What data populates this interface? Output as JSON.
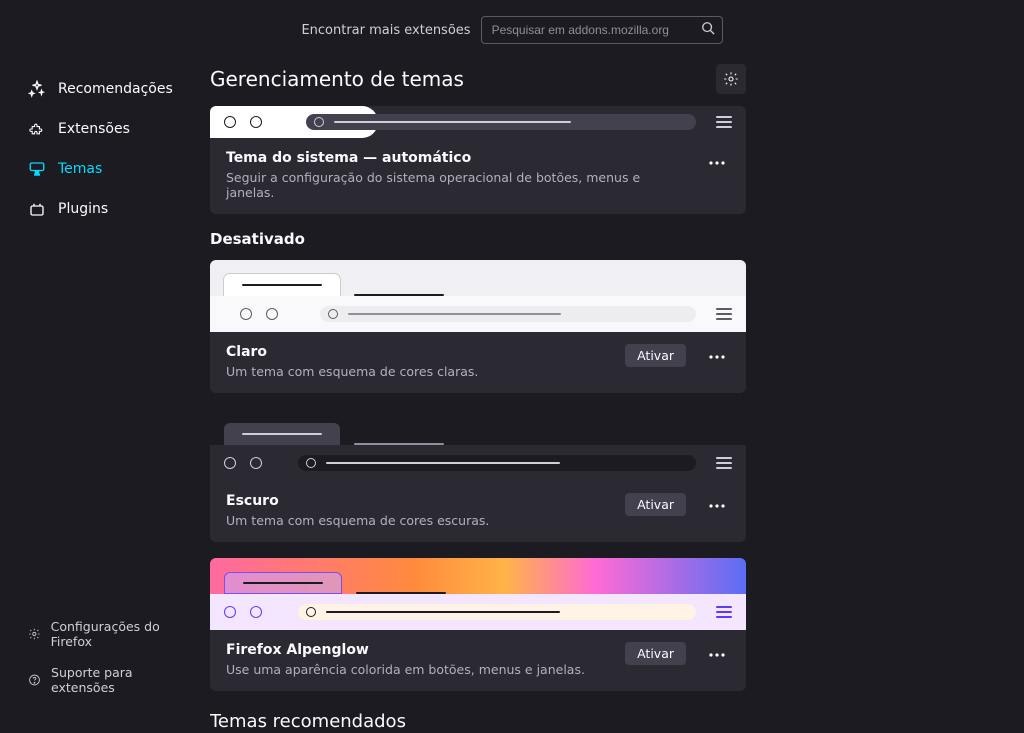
{
  "search": {
    "label": "Encontrar mais extensões",
    "placeholder": "Pesquisar em addons.mozilla.org"
  },
  "sidebar": {
    "items": [
      {
        "label": "Recomendações"
      },
      {
        "label": "Extensões"
      },
      {
        "label": "Temas"
      },
      {
        "label": "Plugins"
      }
    ]
  },
  "footer": {
    "settings": "Configurações do Firefox",
    "support": "Suporte para extensões"
  },
  "main": {
    "title": "Gerenciamento de temas",
    "enabled": {
      "title": "Tema do sistema — automático",
      "desc": "Seguir a configuração do sistema operacional de botões, menus e janelas."
    },
    "disabled_heading": "Desativado",
    "activate_label": "Ativar",
    "themes": [
      {
        "title": "Claro",
        "desc": "Um tema com esquema de cores claras."
      },
      {
        "title": "Escuro",
        "desc": "Um tema com esquema de cores escuras."
      },
      {
        "title": "Firefox Alpenglow",
        "desc": "Use uma aparência colorida em botões, menus e janelas."
      }
    ],
    "recommended_heading": "Temas recomendados"
  }
}
